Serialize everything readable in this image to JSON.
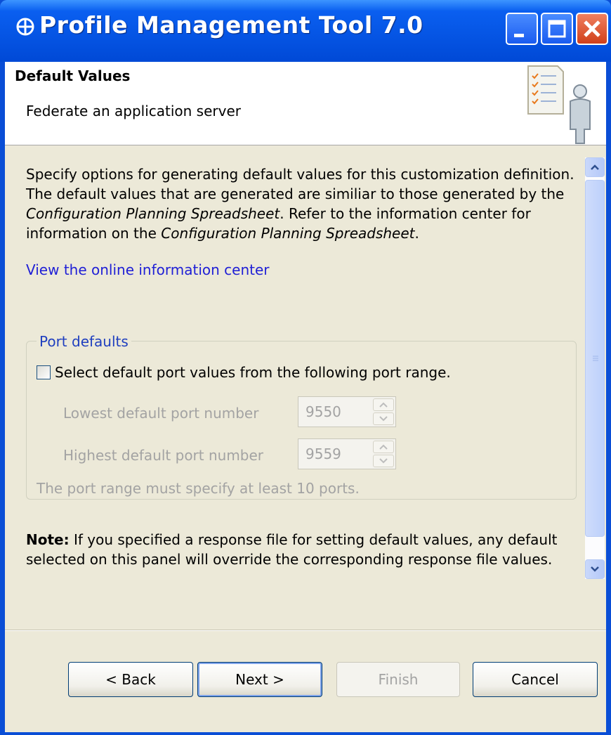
{
  "window": {
    "title": "Profile Management Tool 7.0",
    "titlebar_color": "#0554e3",
    "close_button_color": "#d0401a"
  },
  "header": {
    "title": "Default Values",
    "subtitle": "Federate an application server",
    "icon": "checklist-person-icon"
  },
  "content": {
    "description_parts": [
      "Specify options for generating default values for this customization definition. The default values that are generated are similiar to those generated by the ",
      "Configuration Planning Spreadsheet",
      ". Refer to the information center for information on the ",
      "Configuration Planning Spreadsheet",
      "."
    ],
    "link_text": "View the online information center",
    "port_defaults": {
      "legend": "Port defaults",
      "checkbox_label": "Select default port values from the following port range.",
      "checkbox_checked": false,
      "lowest_label": "Lowest default port number",
      "lowest_value": "9550",
      "highest_label": "Highest default port number",
      "highest_value": "9559",
      "range_note": "The port range must specify at least 10 ports."
    },
    "note_label": "Note:",
    "note_text": " If you specified a response file for setting default values, any default selected on this panel will override the corresponding response file values."
  },
  "buttons": {
    "back": "< Back",
    "next": "Next >",
    "finish": "Finish",
    "cancel": "Cancel"
  },
  "colors": {
    "link": "#1f1fd6",
    "legend": "#1f3fbf",
    "disabled_text": "#a3a3a3",
    "dialog_background": "#ece9d8"
  }
}
